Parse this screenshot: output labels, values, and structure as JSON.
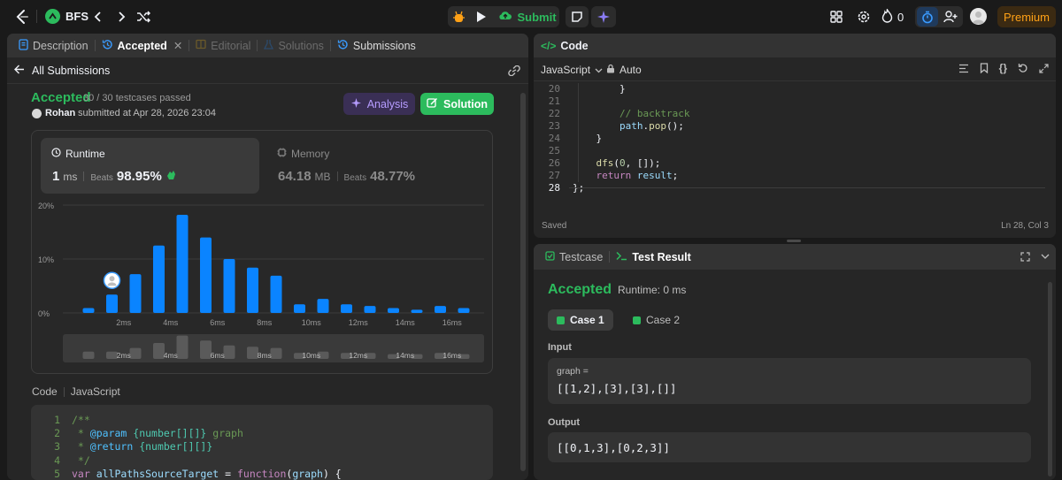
{
  "topbar": {
    "problem_list_label": "BFS",
    "submit_label": "Submit",
    "streak_count": "0",
    "premium_label": "Premium"
  },
  "left_panel": {
    "tabs": [
      {
        "label": "Description"
      },
      {
        "label": "Accepted"
      },
      {
        "label": "Editorial"
      },
      {
        "label": "Solutions"
      },
      {
        "label": "Submissions"
      }
    ],
    "back_label": "All Submissions",
    "status": "Accepted",
    "testcases_passed": "30 / 30 testcases passed",
    "user": "Rohan",
    "submitted_text": "submitted at Apr 28, 2026 23:04",
    "analysis_label": "Analysis",
    "solution_label": "Solution",
    "runtime": {
      "title": "Runtime",
      "value": "1",
      "unit": "ms",
      "beats_label": "Beats",
      "beats_value": "98.95%"
    },
    "memory": {
      "title": "Memory",
      "value": "64.18",
      "unit": "MB",
      "beats_label": "Beats",
      "beats_value": "48.77%"
    },
    "code_label": "Code",
    "language_label": "JavaScript",
    "code_lines": [
      {
        "n": "1",
        "text": "/**"
      },
      {
        "n": "2",
        "text": " * @param {number[][]} graph"
      },
      {
        "n": "3",
        "text": " * @return {number[][]}"
      },
      {
        "n": "4",
        "text": " */"
      },
      {
        "n": "5",
        "text": "var allPathsSourceTarget = function(graph) {"
      }
    ]
  },
  "chart_data": {
    "type": "bar",
    "ylabel_ticks": [
      "20%",
      "10%",
      "0%"
    ],
    "ylim": [
      0,
      20
    ],
    "x_tick_labels": [
      "2ms",
      "4ms",
      "6ms",
      "8ms",
      "10ms",
      "12ms",
      "14ms",
      "16ms"
    ],
    "values": [
      0.9,
      3.4,
      7.2,
      12.5,
      18.2,
      14.0,
      10.0,
      8.4,
      6.9,
      1.6,
      2.6,
      1.6,
      1.3,
      0.9,
      0.6,
      1.3,
      0.9
    ],
    "highlight_index": 1,
    "minimap_values": [
      0.3,
      0.3,
      0.6,
      1.0,
      1.6,
      1.2,
      0.8,
      0.7,
      0.6,
      0.2,
      0.3,
      0.2,
      0.2,
      0.1,
      0.1,
      0.2,
      0.1
    ],
    "grid": true,
    "bar_color": "#0a84ff"
  },
  "code_panel": {
    "title": "Code",
    "language": "JavaScript",
    "auto_label": "Auto",
    "lines": [
      {
        "n": "20",
        "text": "        }"
      },
      {
        "n": "21",
        "text": ""
      },
      {
        "n": "22",
        "text": "        // backtrack"
      },
      {
        "n": "23",
        "text": "        path.pop();"
      },
      {
        "n": "24",
        "text": "    }"
      },
      {
        "n": "25",
        "text": ""
      },
      {
        "n": "26",
        "text": "    dfs(0, []);"
      },
      {
        "n": "27",
        "text": "    return result;"
      },
      {
        "n": "28",
        "text": "};"
      }
    ],
    "saved_label": "Saved",
    "cursor_pos": "Ln 28, Col 3"
  },
  "result_panel": {
    "testcase_tab": "Testcase",
    "result_tab": "Test Result",
    "status": "Accepted",
    "runtime_text": "Runtime: 0 ms",
    "cases": [
      "Case 1",
      "Case 2"
    ],
    "input_label": "Input",
    "input_var": "graph =",
    "input_value": "[[1,2],[3],[3],[]]",
    "output_label": "Output",
    "output_value": "[[0,1,3],[0,2,3]]"
  },
  "colors": {
    "accent_green": "#2cbb5d",
    "accent_blue": "#0a84ff",
    "premium": "#ffa116"
  }
}
